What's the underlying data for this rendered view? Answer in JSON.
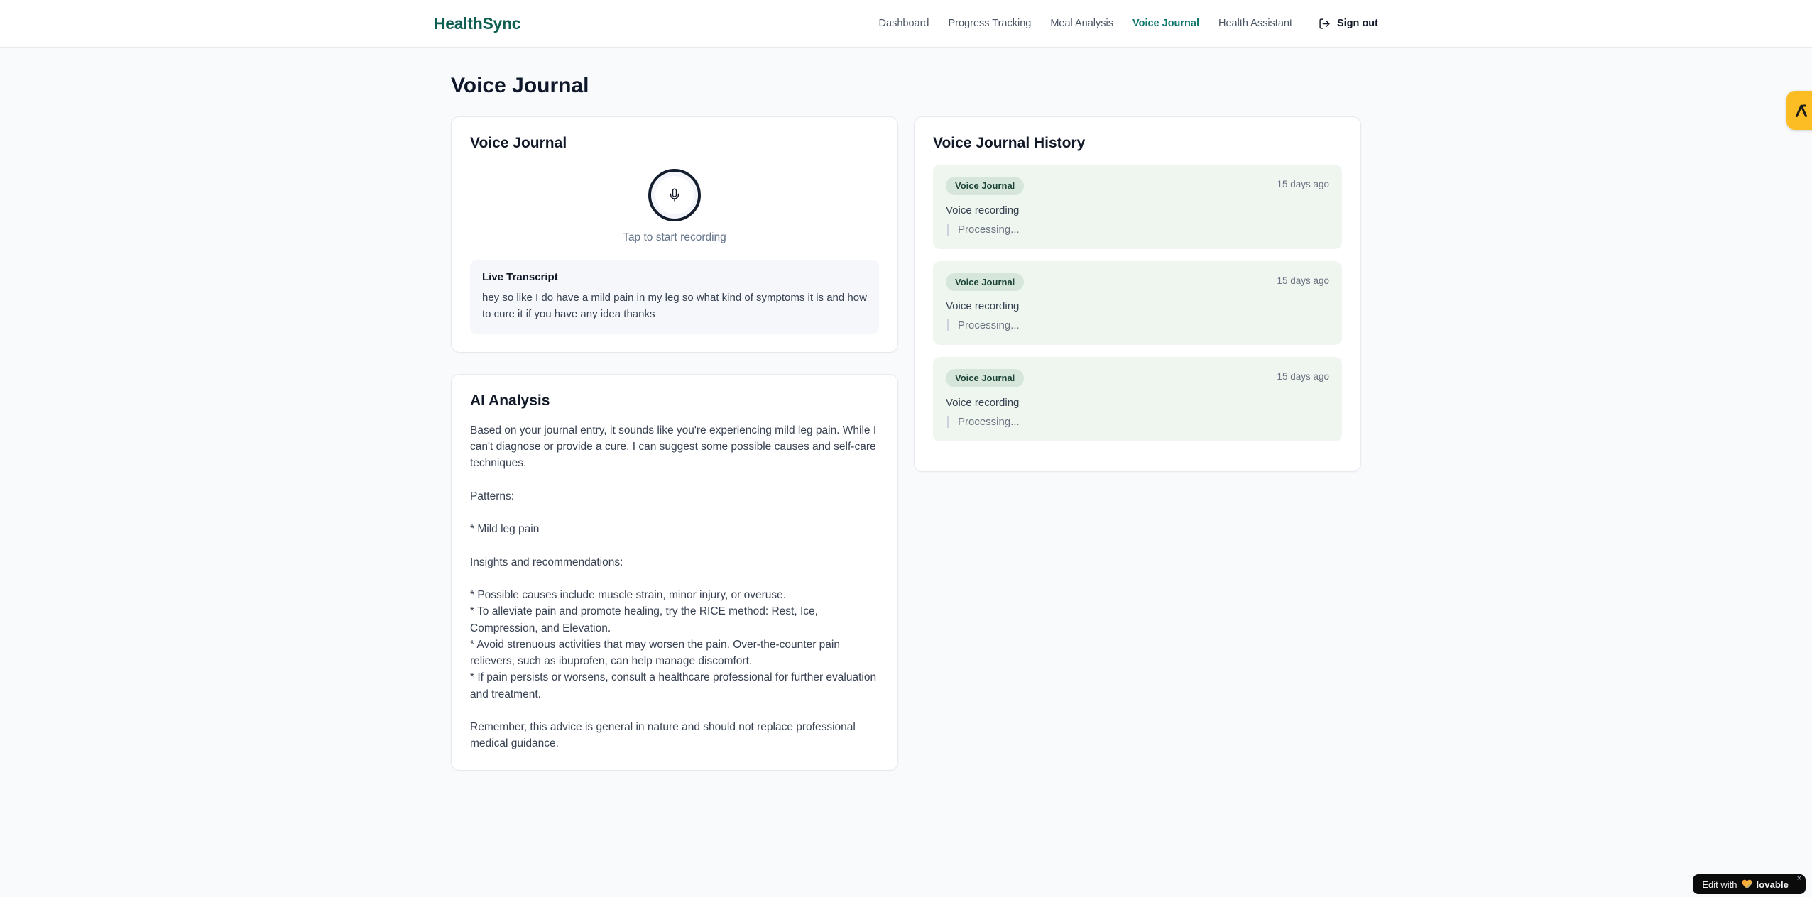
{
  "brand": {
    "name": "HealthSync"
  },
  "nav": {
    "items": [
      {
        "label": "Dashboard",
        "active": false
      },
      {
        "label": "Progress Tracking",
        "active": false
      },
      {
        "label": "Meal Analysis",
        "active": false
      },
      {
        "label": "Voice Journal",
        "active": true
      },
      {
        "label": "Health Assistant",
        "active": false
      }
    ],
    "sign_out_label": "Sign out"
  },
  "page": {
    "title": "Voice Journal"
  },
  "recorder": {
    "card_title": "Voice Journal",
    "tap_hint": "Tap to start recording",
    "transcript_title": "Live Transcript",
    "transcript_text": "hey so like I do have a mild pain in my leg so what kind of symptoms it is and how to cure it if you have any idea thanks"
  },
  "analysis": {
    "card_title": "AI Analysis",
    "body": "Based on your journal entry, it sounds like you're experiencing mild leg pain. While I can't diagnose or provide a cure, I can suggest some possible causes and self-care techniques.\n\nPatterns:\n\n* Mild leg pain\n\nInsights and recommendations:\n\n* Possible causes include muscle strain, minor injury, or overuse.\n* To alleviate pain and promote healing, try the RICE method: Rest, Ice, Compression, and Elevation.\n* Avoid strenuous activities that may worsen the pain. Over-the-counter pain relievers, such as ibuprofen, can help manage discomfort.\n* If pain persists or worsens, consult a healthcare professional for further evaluation and treatment.\n\nRemember, this advice is general in nature and should not replace professional medical guidance."
  },
  "history": {
    "card_title": "Voice Journal History",
    "entries": [
      {
        "badge": "Voice Journal",
        "time": "15 days ago",
        "title": "Voice recording",
        "status": "Processing..."
      },
      {
        "badge": "Voice Journal",
        "time": "15 days ago",
        "title": "Voice recording",
        "status": "Processing..."
      },
      {
        "badge": "Voice Journal",
        "time": "15 days ago",
        "title": "Voice recording",
        "status": "Processing..."
      }
    ]
  },
  "widgets": {
    "edit_prefix": "Edit with",
    "edit_brand": "lovable",
    "close_label": "×"
  },
  "colors": {
    "brand_teal": "#0e5e51",
    "nav_active": "#0f766e",
    "page_bg": "#f8fafc",
    "history_entry_bg": "#eef6ef",
    "badge_bg": "#d7e6db",
    "badge_text": "#1c4437",
    "side_badge_amber": "#fbbd23",
    "edit_pill_bg": "#0b0b0c"
  }
}
